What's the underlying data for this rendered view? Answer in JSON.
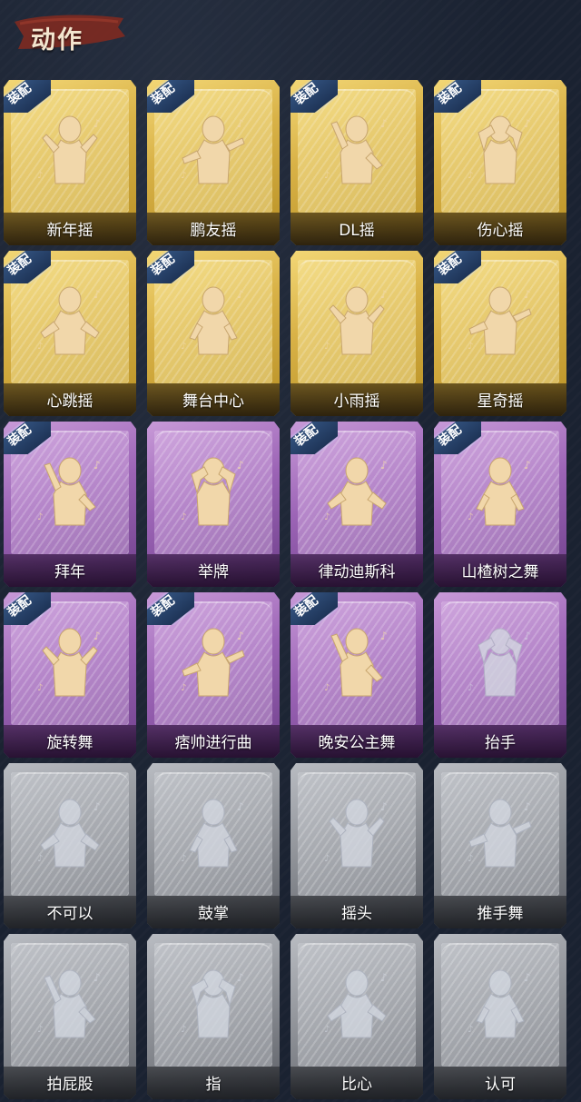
{
  "header": {
    "title": "动作"
  },
  "badge_text": "装配",
  "colors": {
    "gold": "#d9b247",
    "purple": "#9c64b6",
    "grey": "#8f9298",
    "background": "#1a2231",
    "figure_active": "#f1d7aa",
    "figure_locked": "#d7dbe4"
  },
  "cards": [
    {
      "label": "新年摇",
      "tier": "gold",
      "equipped": true,
      "icon": "new-year-shake-icon"
    },
    {
      "label": "鹏友摇",
      "tier": "gold",
      "equipped": true,
      "icon": "friend-shake-icon"
    },
    {
      "label": "DL摇",
      "tier": "gold",
      "equipped": true,
      "icon": "dl-shake-icon"
    },
    {
      "label": "伤心摇",
      "tier": "gold",
      "equipped": true,
      "icon": "heartbreak-shake-icon"
    },
    {
      "label": "心跳摇",
      "tier": "gold",
      "equipped": true,
      "icon": "heartbeat-shake-icon"
    },
    {
      "label": "舞台中心",
      "tier": "gold",
      "equipped": true,
      "icon": "center-stage-icon"
    },
    {
      "label": "小雨摇",
      "tier": "gold",
      "equipped": false,
      "icon": "light-rain-shake-icon"
    },
    {
      "label": "星奇摇",
      "tier": "gold",
      "equipped": true,
      "icon": "star-shake-icon"
    },
    {
      "label": "拜年",
      "tier": "purple",
      "equipped": true,
      "icon": "new-year-greeting-icon"
    },
    {
      "label": "举牌",
      "tier": "purple",
      "equipped": false,
      "icon": "hold-sign-icon"
    },
    {
      "label": "律动迪斯科",
      "tier": "purple",
      "equipped": true,
      "icon": "disco-icon"
    },
    {
      "label": "山楂树之舞",
      "tier": "purple",
      "equipped": true,
      "icon": "hawthorn-dance-icon"
    },
    {
      "label": "旋转舞",
      "tier": "purple",
      "equipped": true,
      "icon": "spin-dance-icon"
    },
    {
      "label": "痞帅进行曲",
      "tier": "purple",
      "equipped": true,
      "icon": "cool-march-icon"
    },
    {
      "label": "晚安公主舞",
      "tier": "purple",
      "equipped": true,
      "icon": "goodnight-princess-icon"
    },
    {
      "label": "抬手",
      "tier": "purple",
      "equipped": false,
      "icon": "raise-hand-icon",
      "locked": true
    },
    {
      "label": "不可以",
      "tier": "grey",
      "equipped": false,
      "icon": "no-finger-icon",
      "locked": true
    },
    {
      "label": "鼓掌",
      "tier": "grey",
      "equipped": false,
      "icon": "clap-icon",
      "locked": true
    },
    {
      "label": "摇头",
      "tier": "grey",
      "equipped": false,
      "icon": "shake-head-icon",
      "locked": true
    },
    {
      "label": "推手舞",
      "tier": "grey",
      "equipped": false,
      "icon": "push-hand-dance-icon",
      "locked": true
    },
    {
      "label": "拍屁股",
      "tier": "grey",
      "equipped": false,
      "icon": "pat-butt-icon",
      "locked": true
    },
    {
      "label": "指",
      "tier": "grey",
      "equipped": false,
      "icon": "point-icon",
      "locked": true
    },
    {
      "label": "比心",
      "tier": "grey",
      "equipped": false,
      "icon": "finger-heart-icon",
      "locked": true
    },
    {
      "label": "认可",
      "tier": "grey",
      "equipped": false,
      "icon": "thumbs-up-icon",
      "locked": true
    }
  ]
}
